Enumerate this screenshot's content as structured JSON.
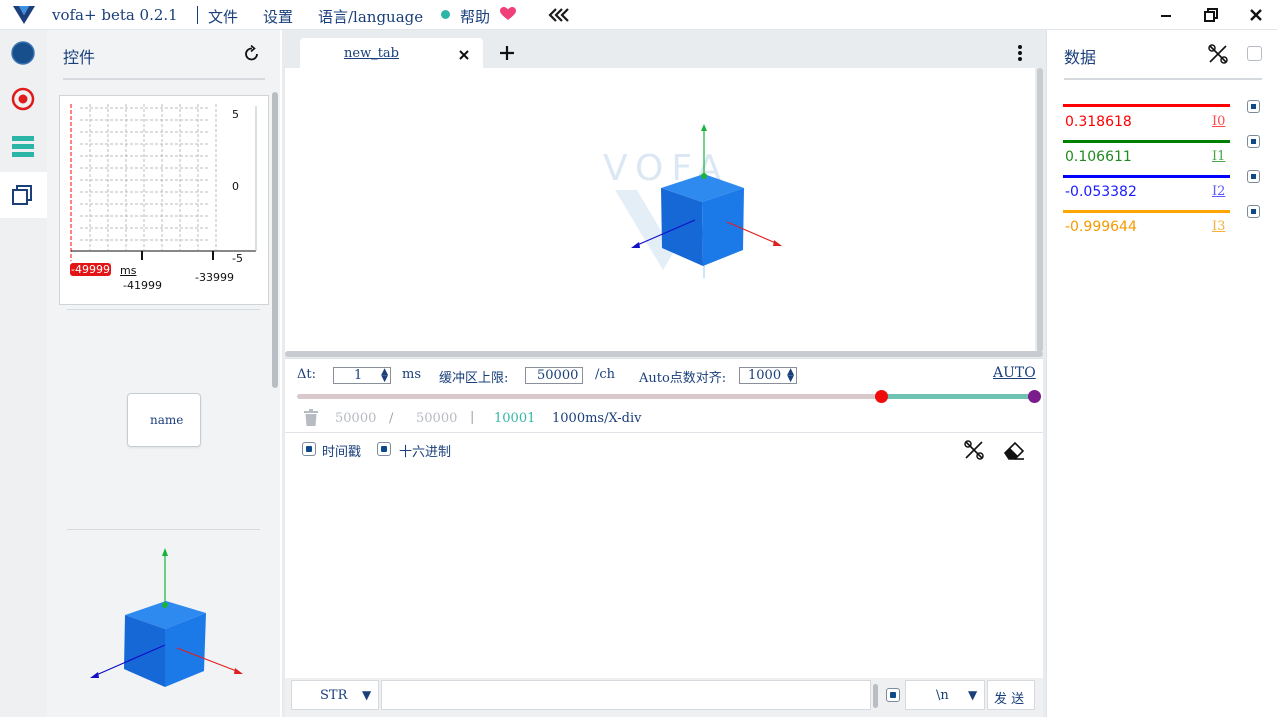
{
  "titlebar": {
    "app_title": "vofa+ beta 0.2.1",
    "menu": [
      "文件",
      "设置",
      "语言/language"
    ],
    "help_label": "帮助",
    "collapse_glyph": "«"
  },
  "left_panel": {
    "title": "控件",
    "plot": {
      "y_ticks": [
        "5",
        "0",
        "-5"
      ],
      "x_tick_left": "-49999",
      "x_unit": "ms",
      "x_tick_mid": "-41999",
      "x_tick_right": "-33999"
    },
    "button_widget_label": "name"
  },
  "center": {
    "tab_label": "new_tab",
    "watermark": "VOFA",
    "dt_label": "Δt:",
    "dt_value": "1",
    "dt_unit": "ms",
    "buffer_label": "缓冲区上限:",
    "buffer_value": "50000",
    "buffer_unit": "/ch",
    "auto_align_label": "Auto点数对齐:",
    "auto_align_value": "1000",
    "auto_label": "AUTO",
    "stats_a": "50000",
    "stats_slash": "/",
    "stats_b": "50000",
    "stats_bar": "|",
    "stats_points": "10001",
    "stats_div": "1000ms/X-div",
    "timestamp_label": "时间戳",
    "hex_label": "十六进制",
    "send_mode": "STR",
    "line_ending": "\\n",
    "send_label": "发 送"
  },
  "right_panel": {
    "title": "数据",
    "channels": [
      {
        "value": "0.318618",
        "name": "I0",
        "color": "#ff0000"
      },
      {
        "value": "0.106611",
        "name": "I1",
        "color": "#008000"
      },
      {
        "value": "-0.053382",
        "name": "I2",
        "color": "#0000ff"
      },
      {
        "value": "-0.999644",
        "name": "I3",
        "color": "#ffa500"
      }
    ]
  },
  "colors": {
    "accent": "#1a3f7a",
    "cube": "#1e7be6",
    "slider_left": "#d9c9cc",
    "slider_right": "#6fc3b2",
    "stats_points": "#35b6a8"
  }
}
